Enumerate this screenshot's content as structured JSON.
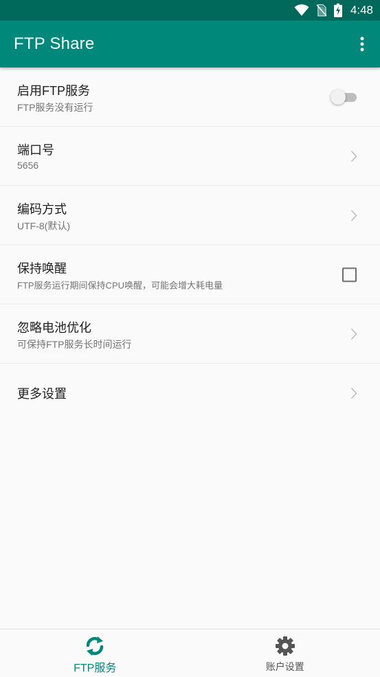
{
  "status_bar": {
    "time": "4:48",
    "icons": [
      "wifi-icon",
      "no-sim-icon",
      "battery-charging-icon"
    ]
  },
  "app_bar": {
    "title": "FTP Share",
    "menu_icon": "more-vert-icon"
  },
  "settings": {
    "enable_ftp": {
      "title": "启用FTP服务",
      "subtitle": "FTP服务没有运行",
      "toggle_on": false
    },
    "port": {
      "title": "端口号",
      "value": "5656"
    },
    "encoding": {
      "title": "编码方式",
      "value": "UTF-8(默认)"
    },
    "keep_awake": {
      "title": "保持唤醒",
      "subtitle": "FTP服务运行期间保持CPU唤醒，可能会增大耗电量",
      "checked": false
    },
    "ignore_battery": {
      "title": "忽略电池优化",
      "subtitle": "可保持FTP服务长时间运行"
    },
    "more": {
      "title": "更多设置"
    }
  },
  "bottom_nav": {
    "items": [
      {
        "label": "FTP服务",
        "icon": "sync-icon",
        "active": true
      },
      {
        "label": "账户设置",
        "icon": "gear-icon",
        "active": false
      }
    ]
  },
  "colors": {
    "status_bar": "#00695c",
    "app_bar": "#00897b",
    "accent": "#00897b"
  }
}
